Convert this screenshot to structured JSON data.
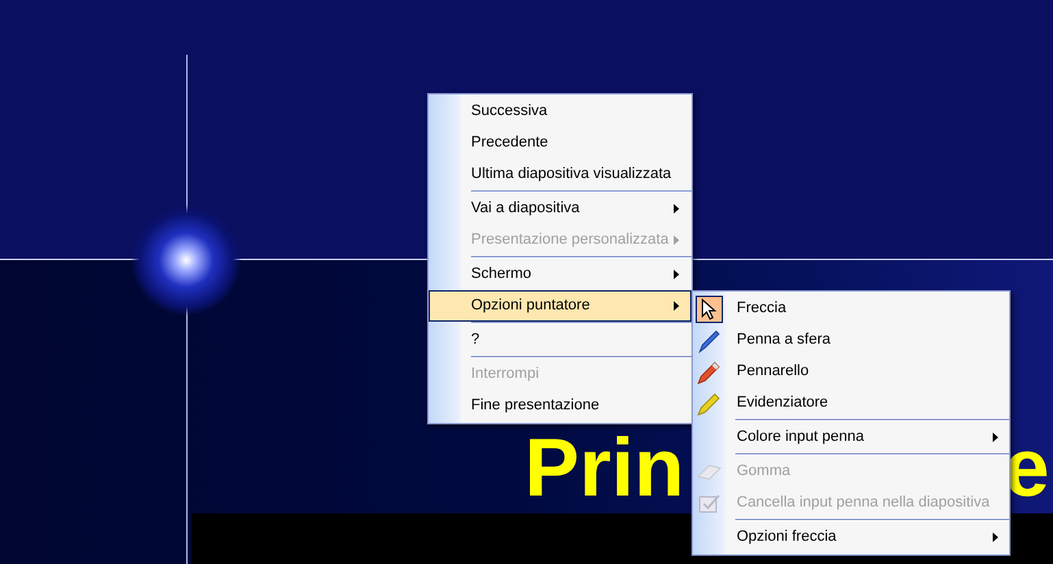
{
  "slide": {
    "title_parts": [
      "Prin",
      "e"
    ]
  },
  "menu": {
    "items": [
      {
        "label": "Successiva",
        "disabled": false,
        "submenu": false,
        "selected": false,
        "separator_before": false
      },
      {
        "label": "Precedente",
        "disabled": false,
        "submenu": false,
        "selected": false,
        "separator_before": false
      },
      {
        "label": "Ultima diapositiva visualizzata",
        "disabled": false,
        "submenu": false,
        "selected": false,
        "separator_before": false
      },
      {
        "label": "Vai a diapositiva",
        "disabled": false,
        "submenu": true,
        "selected": false,
        "separator_before": true
      },
      {
        "label": "Presentazione personalizzata",
        "disabled": true,
        "submenu": true,
        "selected": false,
        "separator_before": false
      },
      {
        "label": "Schermo",
        "disabled": false,
        "submenu": true,
        "selected": false,
        "separator_before": true
      },
      {
        "label": "Opzioni puntatore",
        "disabled": false,
        "submenu": true,
        "selected": true,
        "separator_before": false
      },
      {
        "label": "?",
        "disabled": false,
        "submenu": false,
        "selected": false,
        "separator_before": true
      },
      {
        "label": "Interrompi",
        "disabled": true,
        "submenu": false,
        "selected": false,
        "separator_before": true
      },
      {
        "label": "Fine presentazione",
        "disabled": false,
        "submenu": false,
        "selected": false,
        "separator_before": false
      }
    ]
  },
  "submenu": {
    "items": [
      {
        "label": "Freccia",
        "kind": "arrow",
        "checked": true,
        "disabled": false,
        "submenu": false,
        "separator_before": false
      },
      {
        "label": "Penna a sfera",
        "kind": "pen",
        "checked": false,
        "disabled": false,
        "submenu": false,
        "separator_before": false
      },
      {
        "label": "Pennarello",
        "kind": "marker",
        "checked": false,
        "disabled": false,
        "submenu": false,
        "separator_before": false
      },
      {
        "label": "Evidenziatore",
        "kind": "highlighter",
        "checked": false,
        "disabled": false,
        "submenu": false,
        "separator_before": false
      },
      {
        "label": "Colore input penna",
        "kind": "plain",
        "checked": false,
        "disabled": false,
        "submenu": true,
        "separator_before": true
      },
      {
        "label": "Gomma",
        "kind": "eraser",
        "checked": false,
        "disabled": true,
        "submenu": false,
        "separator_before": true
      },
      {
        "label": "Cancella input penna nella diapositiva",
        "kind": "clear",
        "checked": false,
        "disabled": true,
        "submenu": false,
        "separator_before": false
      },
      {
        "label": "Opzioni freccia",
        "kind": "plain",
        "checked": false,
        "disabled": false,
        "submenu": true,
        "separator_before": true
      }
    ]
  }
}
